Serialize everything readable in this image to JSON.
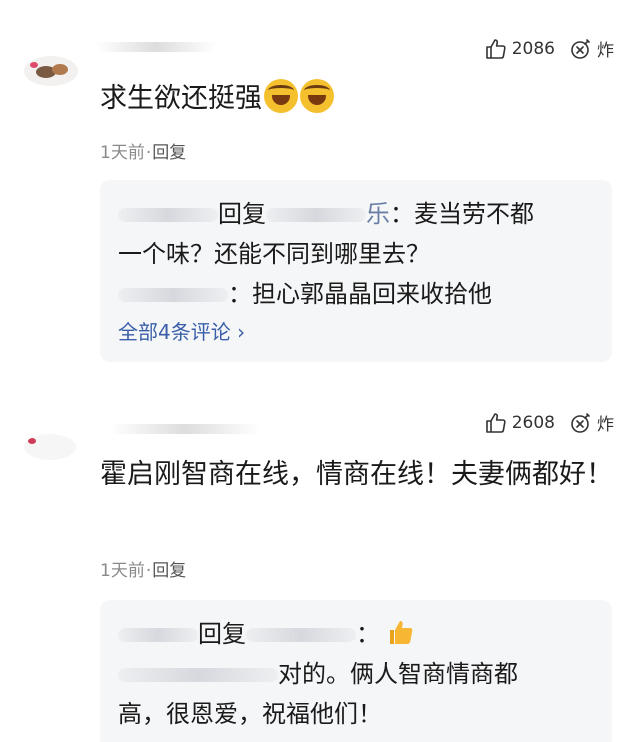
{
  "comments": [
    {
      "likes": "2086",
      "boom_label": "炸",
      "text": "求生欲还挺强",
      "emoji": [
        "laughing-crying-face",
        "laughing-crying-face"
      ],
      "time": "1天前",
      "separator": "·",
      "reply_label": "回复",
      "replies": [
        {
          "reply_word": "回复",
          "name_tail": "乐",
          "content_line1": "：麦当劳不都",
          "content_line2": "一个味？还能不同到哪里去？"
        },
        {
          "content": "：担心郭晶晶回来收拾他"
        }
      ],
      "view_all": "全部4条评论 ›"
    },
    {
      "likes": "2608",
      "boom_label": "炸",
      "text": "霍启刚智商在线，情商在线！夫妻俩都好！",
      "time": "1天前",
      "separator": "·",
      "reply_label": "回复",
      "replies": [
        {
          "reply_word": "回复",
          "content": "："
        },
        {
          "content_line1": "对的。俩人智商情商都",
          "content_line2": "高，很恩爱，祝福他们！"
        }
      ]
    }
  ],
  "colors": {
    "link": "#3a5fa8",
    "meta": "#8a8a8a",
    "reply_bg": "#f5f6f8"
  }
}
